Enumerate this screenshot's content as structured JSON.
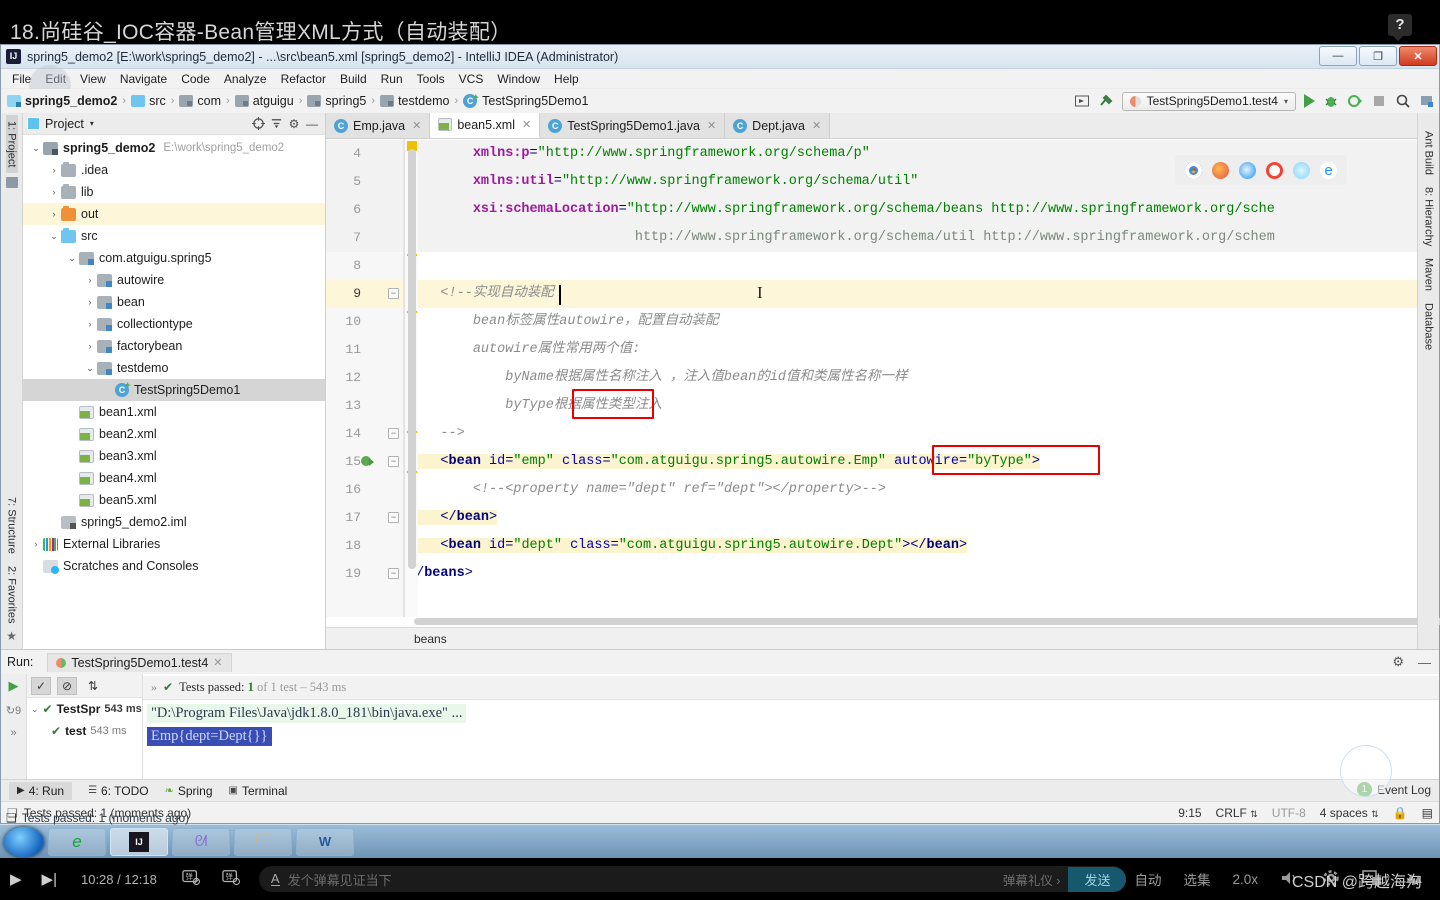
{
  "video": {
    "title": "18.尚硅谷_IOC容器-Bean管理XML方式（自动装配）",
    "help_badge": "?",
    "time": "10:28 / 12:18",
    "danmu_placeholder": "发个弹幕见证当下",
    "danmu_etiquette": "弹幕礼仪 ›",
    "danmu_send": "发送",
    "auto": "自动",
    "episodes": "选集",
    "speed": "2.0x",
    "watermark": "CSDN @跨越海沟"
  },
  "window": {
    "title": "spring5_demo2 [E:\\work\\spring5_demo2] - ...\\src\\bean5.xml [spring5_demo2] - IntelliJ IDEA (Administrator)",
    "logo": "IJ",
    "minimize": "—",
    "maximize": "❐",
    "close": "✕"
  },
  "menubar": [
    "File",
    "Edit",
    "View",
    "Navigate",
    "Code",
    "Analyze",
    "Refactor",
    "Build",
    "Run",
    "Tools",
    "VCS",
    "Window",
    "Help"
  ],
  "navbar": {
    "crumbs": [
      {
        "label": "spring5_demo2",
        "icon": "module-icon",
        "bold": true
      },
      {
        "label": "src",
        "icon": "source-folder-icon",
        "bold": false
      },
      {
        "label": "com",
        "icon": "package-icon",
        "bold": false
      },
      {
        "label": "atguigu",
        "icon": "package-icon",
        "bold": false
      },
      {
        "label": "spring5",
        "icon": "package-icon",
        "bold": false
      },
      {
        "label": "testdemo",
        "icon": "package-icon",
        "bold": false
      },
      {
        "label": "TestSpring5Demo1",
        "icon": "java-class-icon",
        "bold": false
      }
    ],
    "run_config": "TestSpring5Demo1.test4",
    "separator": "›"
  },
  "left_strip": [
    "1: Project",
    "7: Structure",
    "2: Favorites"
  ],
  "right_strip": [
    "Ant Build",
    "8: Hierarchy",
    "Maven",
    "Database"
  ],
  "project_panel": {
    "title": "Project",
    "caret": "▾",
    "tree": [
      {
        "depth": 0,
        "arrow": "⌄",
        "icon": "module-icon",
        "label": "spring5_demo2",
        "note": "E:\\work\\spring5_demo2",
        "bold": true,
        "state": "none"
      },
      {
        "depth": 1,
        "arrow": "›",
        "icon": "folder-icon",
        "label": ".idea",
        "note": "",
        "bold": false,
        "state": "none"
      },
      {
        "depth": 1,
        "arrow": "›",
        "icon": "folder-icon",
        "label": "lib",
        "note": "",
        "bold": false,
        "state": "none"
      },
      {
        "depth": 1,
        "arrow": "›",
        "icon": "folder-orange-icon",
        "label": "out",
        "note": "",
        "bold": false,
        "state": "highlight"
      },
      {
        "depth": 1,
        "arrow": "⌄",
        "icon": "source-folder-icon",
        "label": "src",
        "note": "",
        "bold": false,
        "state": "none"
      },
      {
        "depth": 2,
        "arrow": "⌄",
        "icon": "package-icon",
        "label": "com.atguigu.spring5",
        "note": "",
        "bold": false,
        "state": "none"
      },
      {
        "depth": 3,
        "arrow": "›",
        "icon": "package-icon",
        "label": "autowire",
        "note": "",
        "bold": false,
        "state": "none"
      },
      {
        "depth": 3,
        "arrow": "›",
        "icon": "package-icon",
        "label": "bean",
        "note": "",
        "bold": false,
        "state": "none"
      },
      {
        "depth": 3,
        "arrow": "›",
        "icon": "package-icon",
        "label": "collectiontype",
        "note": "",
        "bold": false,
        "state": "none"
      },
      {
        "depth": 3,
        "arrow": "›",
        "icon": "package-icon",
        "label": "factorybean",
        "note": "",
        "bold": false,
        "state": "none"
      },
      {
        "depth": 3,
        "arrow": "⌄",
        "icon": "package-icon",
        "label": "testdemo",
        "note": "",
        "bold": false,
        "state": "none"
      },
      {
        "depth": 4,
        "arrow": "",
        "icon": "java-class-icon",
        "label": "TestSpring5Demo1",
        "note": "",
        "bold": false,
        "state": "selected"
      },
      {
        "depth": 2,
        "arrow": "",
        "icon": "xml-file-icon",
        "label": "bean1.xml",
        "note": "",
        "bold": false,
        "state": "none"
      },
      {
        "depth": 2,
        "arrow": "",
        "icon": "xml-file-icon",
        "label": "bean2.xml",
        "note": "",
        "bold": false,
        "state": "none"
      },
      {
        "depth": 2,
        "arrow": "",
        "icon": "xml-file-icon",
        "label": "bean3.xml",
        "note": "",
        "bold": false,
        "state": "none"
      },
      {
        "depth": 2,
        "arrow": "",
        "icon": "xml-file-icon",
        "label": "bean4.xml",
        "note": "",
        "bold": false,
        "state": "none"
      },
      {
        "depth": 2,
        "arrow": "",
        "icon": "xml-file-icon",
        "label": "bean5.xml",
        "note": "",
        "bold": false,
        "state": "none"
      },
      {
        "depth": 1,
        "arrow": "",
        "icon": "iml-file-icon",
        "label": "spring5_demo2.iml",
        "note": "",
        "bold": false,
        "state": "none"
      },
      {
        "depth": 0,
        "arrow": "›",
        "icon": "external-libraries-icon",
        "label": "External Libraries",
        "note": "",
        "bold": false,
        "state": "none"
      },
      {
        "depth": 0,
        "arrow": "",
        "icon": "scratches-icon",
        "label": "Scratches and Consoles",
        "note": "",
        "bold": false,
        "state": "none"
      }
    ]
  },
  "editor": {
    "tabs": [
      {
        "label": "Emp.java",
        "icon": "java-class-icon",
        "active": false
      },
      {
        "label": "bean5.xml",
        "icon": "xml-file-icon",
        "active": true
      },
      {
        "label": "TestSpring5Demo1.java",
        "icon": "java-class-icon",
        "active": false
      },
      {
        "label": "Dept.java",
        "icon": "java-class-icon",
        "active": false
      }
    ],
    "breadcrumb": "beans",
    "lines": [
      {
        "n": 4,
        "text": "        xmlns:p=\"http://www.springframework.org/schema/p\""
      },
      {
        "n": 5,
        "text": "        xmlns:util=\"http://www.springframework.org/schema/util\""
      },
      {
        "n": 6,
        "text": "        xsi:schemaLocation=\"http://www.springframework.org/schema/beans http://www.springframework.org/sche"
      },
      {
        "n": 7,
        "text": "                            http://www.springframework.org/schema/util http://www.springframework.org/schem"
      },
      {
        "n": 8,
        "text": ""
      },
      {
        "n": 9,
        "text": "    <!--实现自动装配"
      },
      {
        "n": 10,
        "text": "        bean标签属性autowire，配置自动装配"
      },
      {
        "n": 11,
        "text": "        autowire属性常用两个值:"
      },
      {
        "n": 12,
        "text": "            byName根据属性名称注入 ，注入值bean的id值和类属性名称一样"
      },
      {
        "n": 13,
        "text": "            byType根据属性类型注入"
      },
      {
        "n": 14,
        "text": "    -->"
      },
      {
        "n": 15,
        "text": "    <bean id=\"emp\" class=\"com.atguigu.spring5.autowire.Emp\" autowire=\"byType\">"
      },
      {
        "n": 16,
        "text": "        <!--<property name=\"dept\" ref=\"dept\"></property>-->"
      },
      {
        "n": 17,
        "text": "    </bean>"
      },
      {
        "n": 18,
        "text": "    <bean id=\"dept\" class=\"com.atguigu.spring5.autowire.Dept\"></bean>"
      },
      {
        "n": 19,
        "text": "</beans>"
      }
    ],
    "annotations": [
      "属性类型 highlighted in red box",
      "autowire=\"byType\" highlighted in red box"
    ]
  },
  "run_window": {
    "label": "Run:",
    "tab": "TestSpring5Demo1.test4",
    "status_prefix": "Tests passed: ",
    "status_count": "1",
    "status_suffix": " of 1 test – 543 ms",
    "tree": [
      {
        "label": "TestSpr",
        "time": "543 ms",
        "depth": 0
      },
      {
        "label": "test",
        "time": "543 ms",
        "depth": 1
      }
    ],
    "console": [
      "\"D:\\Program Files\\Java\\jdk1.8.0_181\\bin\\java.exe\" ...",
      "Emp{dept=Dept{}}"
    ]
  },
  "bottom_tabs": [
    {
      "label": "4: Run",
      "icon": "run-icon",
      "selected": true
    },
    {
      "label": "6: TODO",
      "icon": "todo-icon",
      "selected": false
    },
    {
      "label": "Spring",
      "icon": "spring-icon",
      "selected": false
    },
    {
      "label": "Terminal",
      "icon": "terminal-icon",
      "selected": false
    }
  ],
  "statusbar": {
    "message": "Tests passed: 1 (moments ago)",
    "event_log": "Event Log",
    "event_count": "1",
    "caret_pos": "9:15",
    "line_sep": "CRLF",
    "encoding": "UTF-8",
    "indent": "4 spaces"
  },
  "colors": {
    "xml_tag": "#000080",
    "xml_attr": "#0000c0",
    "xml_value": "#008000",
    "xml_ns": "#9b1b9b",
    "comment": "#8c8c8c",
    "highlight_box": "#ea0000",
    "selection_yellow": "#fdf6d8",
    "run_green": "#43a047"
  }
}
